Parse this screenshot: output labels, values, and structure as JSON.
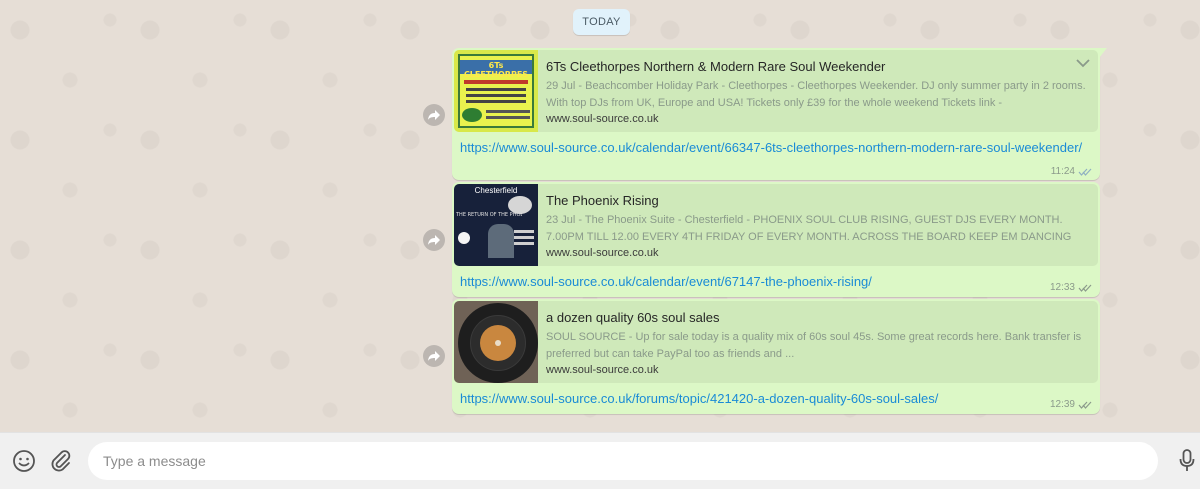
{
  "date_chip": "TODAY",
  "messages": [
    {
      "title": "6Ts Cleethorpes Northern & Modern Rare Soul Weekender",
      "description": "29 Jul - Beachcomber Holiday Park - Cleethorpes - Cleethorpes Weekender. DJ only summer party in 2 rooms. With top DJs from UK, Europe and USA! Tickets only £39 for the whole weekend Tickets link -",
      "domain": "www.soul-source.co.uk",
      "link": "https://www.soul-source.co.uk/calendar/event/66347-6ts-cleethorpes-northern-modern-rare-soul-weekender/",
      "time": "11:24",
      "thumb_text": "6Ts CLEETHORPES",
      "thumb_color": "#d8e84a"
    },
    {
      "title": "The Phoenix Rising",
      "description": "23 Jul - The Phoenix Suite - Chesterfield - PHOENIX SOUL CLUB RISING, GUEST DJS EVERY MONTH. 7.00PM TILL 12.00 EVERY 4TH FRIDAY OF EVERY MONTH. ACROSS THE BOARD KEEP EM DANCING POLICY",
      "domain": "www.soul-source.co.uk",
      "link": "https://www.soul-source.co.uk/calendar/event/67147-the-phoenix-rising/",
      "time": "12:33",
      "thumb_text": "Chesterfield",
      "thumb_subtext": "THE RETURN OF THE PHOENIX",
      "thumb_color": "#17213a"
    },
    {
      "title": "a dozen quality 60s soul sales",
      "description": "SOUL SOURCE - Up for sale today is a quality mix of 60s soul 45s. Some great records here. Bank transfer is preferred but can take PayPal too as friends and ...",
      "domain": "www.soul-source.co.uk",
      "link": "https://www.soul-source.co.uk/forums/topic/421420-a-dozen-quality-60s-soul-sales/",
      "time": "12:39",
      "thumb_color": "#6f6256"
    }
  ],
  "composer": {
    "placeholder": "Type a message"
  },
  "colors": {
    "bubble": "#dcf8c6",
    "link": "#1a8bd6",
    "ticks": "#8fb0c2"
  }
}
